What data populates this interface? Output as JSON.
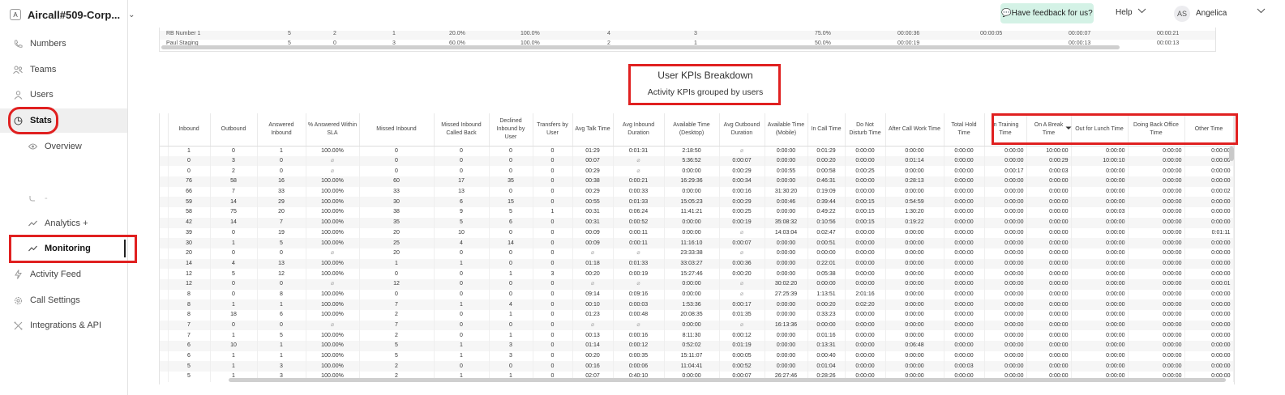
{
  "workspace": {
    "avatar": "A",
    "name": "Aircall#509-Corp...",
    "chevron": "⌄"
  },
  "nav": {
    "numbers": "Numbers",
    "teams": "Teams",
    "users": "Users",
    "stats": "Stats",
    "overview": "Overview",
    "hidden": "‐",
    "analytics": "Analytics +",
    "monitoring": "Monitoring",
    "activity": "Activity Feed",
    "call_settings": "Call Settings",
    "integrations": "Integrations & API"
  },
  "topbar": {
    "feedback": "💬Have feedback for us?",
    "help": "Help",
    "user_initials": "AS",
    "user_name": "Angelica"
  },
  "top_table": {
    "rows": [
      [
        "RB Number 1",
        "5",
        "2",
        "1",
        "20.0%",
        "100.0%",
        "4",
        "3",
        "75.0%",
        "00:00:36",
        "00:00:05",
        "00:00:07",
        "00:00:21"
      ],
      [
        "Paul Staging",
        "5",
        "0",
        "3",
        "60.0%",
        "100.0%",
        "2",
        "1",
        "50.0%",
        "00:00:19",
        "",
        "00:00:13",
        "00:00:13"
      ]
    ]
  },
  "section": {
    "title": "User KPIs Breakdown",
    "subtitle": "Activity KPIs grouped by users"
  },
  "kpi_table": {
    "headers": [
      "Inbound",
      "Outbound",
      "Answered Inbound",
      "% Answered Within SLA",
      "Missed Inbound",
      "Missed Inbound Called Back",
      "Declined Inbound by User",
      "Transfers by User",
      "Avg Talk Time",
      "Avg Inbound Duration",
      "Available Time (Desktop)",
      "Avg Outbound Duration",
      "Available Time (Mobile)",
      "In Call Time",
      "Do Not Disturb Time",
      "After Call Work Time",
      "Total Hold Time",
      "In Training Time",
      "On A Break Time",
      "Out for Lunch Time",
      "Doing Back Office Time",
      "Other Time"
    ],
    "rows": [
      [
        "1",
        "0",
        "1",
        "100.00%",
        "0",
        "0",
        "0",
        "0",
        "01:29",
        "0:01:31",
        "2:18:50",
        "⌀",
        "0:00:00",
        "0:01:29",
        "0:00:00",
        "0:00:00",
        "0:00:00",
        "0:00:00",
        "10:00:00",
        "0:00:00",
        "0:00:00",
        "0:00:00"
      ],
      [
        "0",
        "3",
        "0",
        "⌀",
        "0",
        "0",
        "0",
        "0",
        "00:07",
        "⌀",
        "5:36:52",
        "0:00:07",
        "0:00:00",
        "0:00:20",
        "0:00:00",
        "0:01:14",
        "0:00:00",
        "0:00:00",
        "0:00:29",
        "10:00:10",
        "0:00:00",
        "0:00:00"
      ],
      [
        "0",
        "2",
        "0",
        "⌀",
        "0",
        "0",
        "0",
        "0",
        "00:29",
        "⌀",
        "0:00:00",
        "0:00:29",
        "0:00:55",
        "0:00:58",
        "0:00:25",
        "0:00:00",
        "0:00:00",
        "0:00:17",
        "0:00:03",
        "0:00:00",
        "0:00:00",
        "0:00:00"
      ],
      [
        "76",
        "58",
        "16",
        "100.00%",
        "60",
        "17",
        "35",
        "0",
        "00:38",
        "0:00:21",
        "16:29:36",
        "0:00:34",
        "0:00:00",
        "0:46:31",
        "0:00:00",
        "0:28:13",
        "0:00:00",
        "0:00:00",
        "0:00:00",
        "0:00:00",
        "0:00:00",
        "0:00:00"
      ],
      [
        "66",
        "7",
        "33",
        "100.00%",
        "33",
        "13",
        "0",
        "0",
        "00:29",
        "0:00:33",
        "0:00:00",
        "0:00:16",
        "31:30:20",
        "0:19:09",
        "0:00:00",
        "0:00:00",
        "0:00:00",
        "0:00:00",
        "0:00:00",
        "0:00:00",
        "0:00:00",
        "0:00:02"
      ],
      [
        "59",
        "14",
        "29",
        "100.00%",
        "30",
        "6",
        "15",
        "0",
        "00:55",
        "0:01:33",
        "15:05:23",
        "0:00:29",
        "0:00:46",
        "0:39:44",
        "0:00:15",
        "0:54:59",
        "0:00:00",
        "0:00:00",
        "0:00:00",
        "0:00:00",
        "0:00:00",
        "0:00:00"
      ],
      [
        "58",
        "75",
        "20",
        "100.00%",
        "38",
        "9",
        "5",
        "1",
        "00:31",
        "0:06:24",
        "11:41:21",
        "0:00:25",
        "0:00:00",
        "0:49:22",
        "0:00:15",
        "1:30:20",
        "0:00:00",
        "0:00:00",
        "0:00:00",
        "0:00:03",
        "0:00:00",
        "0:00:00"
      ],
      [
        "42",
        "14",
        "7",
        "100.00%",
        "35",
        "5",
        "6",
        "0",
        "00:31",
        "0:00:52",
        "0:00:00",
        "0:00:19",
        "35:08:32",
        "0:10:56",
        "0:00:15",
        "0:19:22",
        "0:00:00",
        "0:00:00",
        "0:00:00",
        "0:00:00",
        "0:00:00",
        "0:00:00"
      ],
      [
        "39",
        "0",
        "19",
        "100.00%",
        "20",
        "10",
        "0",
        "0",
        "00:09",
        "0:00:11",
        "0:00:00",
        "⌀",
        "14:03:04",
        "0:02:47",
        "0:00:00",
        "0:00:00",
        "0:00:00",
        "0:00:00",
        "0:00:00",
        "0:00:00",
        "0:00:00",
        "0:01:11"
      ],
      [
        "30",
        "1",
        "5",
        "100.00%",
        "25",
        "4",
        "14",
        "0",
        "00:09",
        "0:00:11",
        "11:16:10",
        "0:00:07",
        "0:00:00",
        "0:00:51",
        "0:00:00",
        "0:00:00",
        "0:00:00",
        "0:00:00",
        "0:00:00",
        "0:00:00",
        "0:00:00",
        "0:00:00"
      ],
      [
        "20",
        "0",
        "0",
        "⌀",
        "20",
        "0",
        "0",
        "0",
        "⌀",
        "⌀",
        "23:33:38",
        "⌀",
        "0:00:00",
        "0:00:00",
        "0:00:00",
        "0:00:00",
        "0:00:00",
        "0:00:00",
        "0:00:00",
        "0:00:00",
        "0:00:00",
        "0:00:00"
      ],
      [
        "14",
        "4",
        "13",
        "100.00%",
        "1",
        "1",
        "0",
        "0",
        "01:18",
        "0:01:33",
        "33:03:27",
        "0:00:36",
        "0:00:00",
        "0:22:01",
        "0:00:00",
        "0:00:00",
        "0:00:00",
        "0:00:00",
        "0:00:00",
        "0:00:00",
        "0:00:00",
        "0:00:00"
      ],
      [
        "12",
        "5",
        "12",
        "100.00%",
        "0",
        "0",
        "1",
        "3",
        "00:20",
        "0:00:19",
        "15:27:46",
        "0:00:20",
        "0:00:00",
        "0:05:38",
        "0:00:00",
        "0:00:00",
        "0:00:00",
        "0:00:00",
        "0:00:00",
        "0:00:00",
        "0:00:00",
        "0:00:00"
      ],
      [
        "12",
        "0",
        "0",
        "⌀",
        "12",
        "0",
        "0",
        "0",
        "⌀",
        "⌀",
        "0:00:00",
        "⌀",
        "30:02:20",
        "0:00:00",
        "0:00:00",
        "0:00:00",
        "0:00:00",
        "0:00:00",
        "0:00:00",
        "0:00:00",
        "0:00:00",
        "0:00:01"
      ],
      [
        "8",
        "0",
        "8",
        "100.00%",
        "0",
        "0",
        "0",
        "0",
        "09:14",
        "0:09:16",
        "0:00:00",
        "⌀",
        "27:25:39",
        "1:13:51",
        "2:01:16",
        "0:00:00",
        "0:00:00",
        "0:00:00",
        "0:00:00",
        "0:00:00",
        "0:00:00",
        "0:00:00"
      ],
      [
        "8",
        "1",
        "1",
        "100.00%",
        "7",
        "1",
        "4",
        "0",
        "00:10",
        "0:00:03",
        "1:53:36",
        "0:00:17",
        "0:00:00",
        "0:00:20",
        "0:02:20",
        "0:00:00",
        "0:00:00",
        "0:00:00",
        "0:00:00",
        "0:00:00",
        "0:00:00",
        "0:00:00"
      ],
      [
        "8",
        "18",
        "6",
        "100.00%",
        "2",
        "0",
        "1",
        "0",
        "01:23",
        "0:00:48",
        "20:08:35",
        "0:01:35",
        "0:00:00",
        "0:33:23",
        "0:00:00",
        "0:00:00",
        "0:00:00",
        "0:00:00",
        "0:00:00",
        "0:00:00",
        "0:00:00",
        "0:00:00"
      ],
      [
        "7",
        "0",
        "0",
        "⌀",
        "7",
        "0",
        "0",
        "0",
        "⌀",
        "⌀",
        "0:00:00",
        "⌀",
        "16:13:36",
        "0:00:00",
        "0:00:00",
        "0:00:00",
        "0:00:00",
        "0:00:00",
        "0:00:00",
        "0:00:00",
        "0:00:00",
        "0:00:00"
      ],
      [
        "7",
        "1",
        "5",
        "100.00%",
        "2",
        "0",
        "1",
        "0",
        "00:13",
        "0:00:16",
        "8:11:30",
        "0:00:12",
        "0:00:00",
        "0:01:16",
        "0:00:00",
        "0:00:00",
        "0:00:00",
        "0:00:00",
        "0:00:00",
        "0:00:00",
        "0:00:00",
        "0:00:00"
      ],
      [
        "6",
        "10",
        "1",
        "100.00%",
        "5",
        "1",
        "3",
        "0",
        "01:14",
        "0:00:12",
        "0:52:02",
        "0:01:19",
        "0:00:00",
        "0:13:31",
        "0:00:00",
        "0:06:48",
        "0:00:00",
        "0:00:00",
        "0:00:00",
        "0:00:00",
        "0:00:00",
        "0:00:00"
      ],
      [
        "6",
        "1",
        "1",
        "100.00%",
        "5",
        "1",
        "3",
        "0",
        "00:20",
        "0:00:35",
        "15:11:07",
        "0:00:05",
        "0:00:00",
        "0:00:40",
        "0:00:00",
        "0:00:00",
        "0:00:00",
        "0:00:00",
        "0:00:00",
        "0:00:00",
        "0:00:00",
        "0:00:00"
      ],
      [
        "5",
        "1",
        "3",
        "100.00%",
        "2",
        "0",
        "0",
        "0",
        "00:16",
        "0:00:06",
        "11:04:41",
        "0:00:52",
        "0:00:00",
        "0:01:04",
        "0:00:00",
        "0:00:00",
        "0:00:03",
        "0:00:00",
        "0:00:00",
        "0:00:00",
        "0:00:00",
        "0:00:00"
      ],
      [
        "5",
        "1",
        "3",
        "100.00%",
        "2",
        "1",
        "1",
        "0",
        "02:07",
        "0:40:10",
        "0:00:00",
        "0:00:07",
        "26:27:46",
        "0:28:26",
        "0:00:00",
        "0:00:00",
        "0:00:00",
        "0:00:00",
        "0:00:00",
        "0:00:00",
        "0:00:00",
        "0:00:00"
      ]
    ]
  },
  "colors": {
    "highlight_red": "#e02020",
    "feedback_bg": "#d4f2e6",
    "active_nav_bg": "#efefef"
  }
}
